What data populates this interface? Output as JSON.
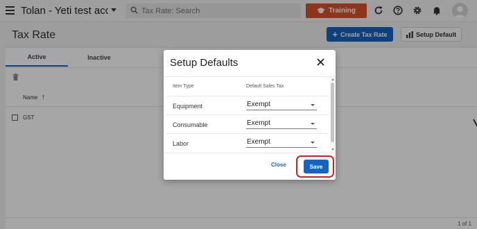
{
  "topbar": {
    "app_title": "Tolan - Yeti test account",
    "search_placeholder": "Tax Rate: Search",
    "training_label": "Training"
  },
  "page": {
    "title": "Tax Rate",
    "create_label": "Create Tax Rate",
    "setup_default_label": "Setup Default"
  },
  "tabs": [
    {
      "label": "Active",
      "active": true
    },
    {
      "label": "Inactive",
      "active": false
    }
  ],
  "table": {
    "column_name": "Name",
    "rows": [
      {
        "name": "GST"
      }
    ]
  },
  "pager": "1 of 1",
  "modal": {
    "title": "Setup Defaults",
    "col_item_type": "Item Type",
    "col_default_tax": "Default Sales Tax",
    "rows": [
      {
        "item_type": "Equipment",
        "default_tax": "Exempt"
      },
      {
        "item_type": "Consumable",
        "default_tax": "Exempt"
      },
      {
        "item_type": "Labor",
        "default_tax": "Exempt"
      }
    ],
    "close_label": "Close",
    "save_label": "Save"
  },
  "colors": {
    "primary": "#1565c0",
    "training": "#d9532b",
    "highlight": "#d21c2a"
  }
}
